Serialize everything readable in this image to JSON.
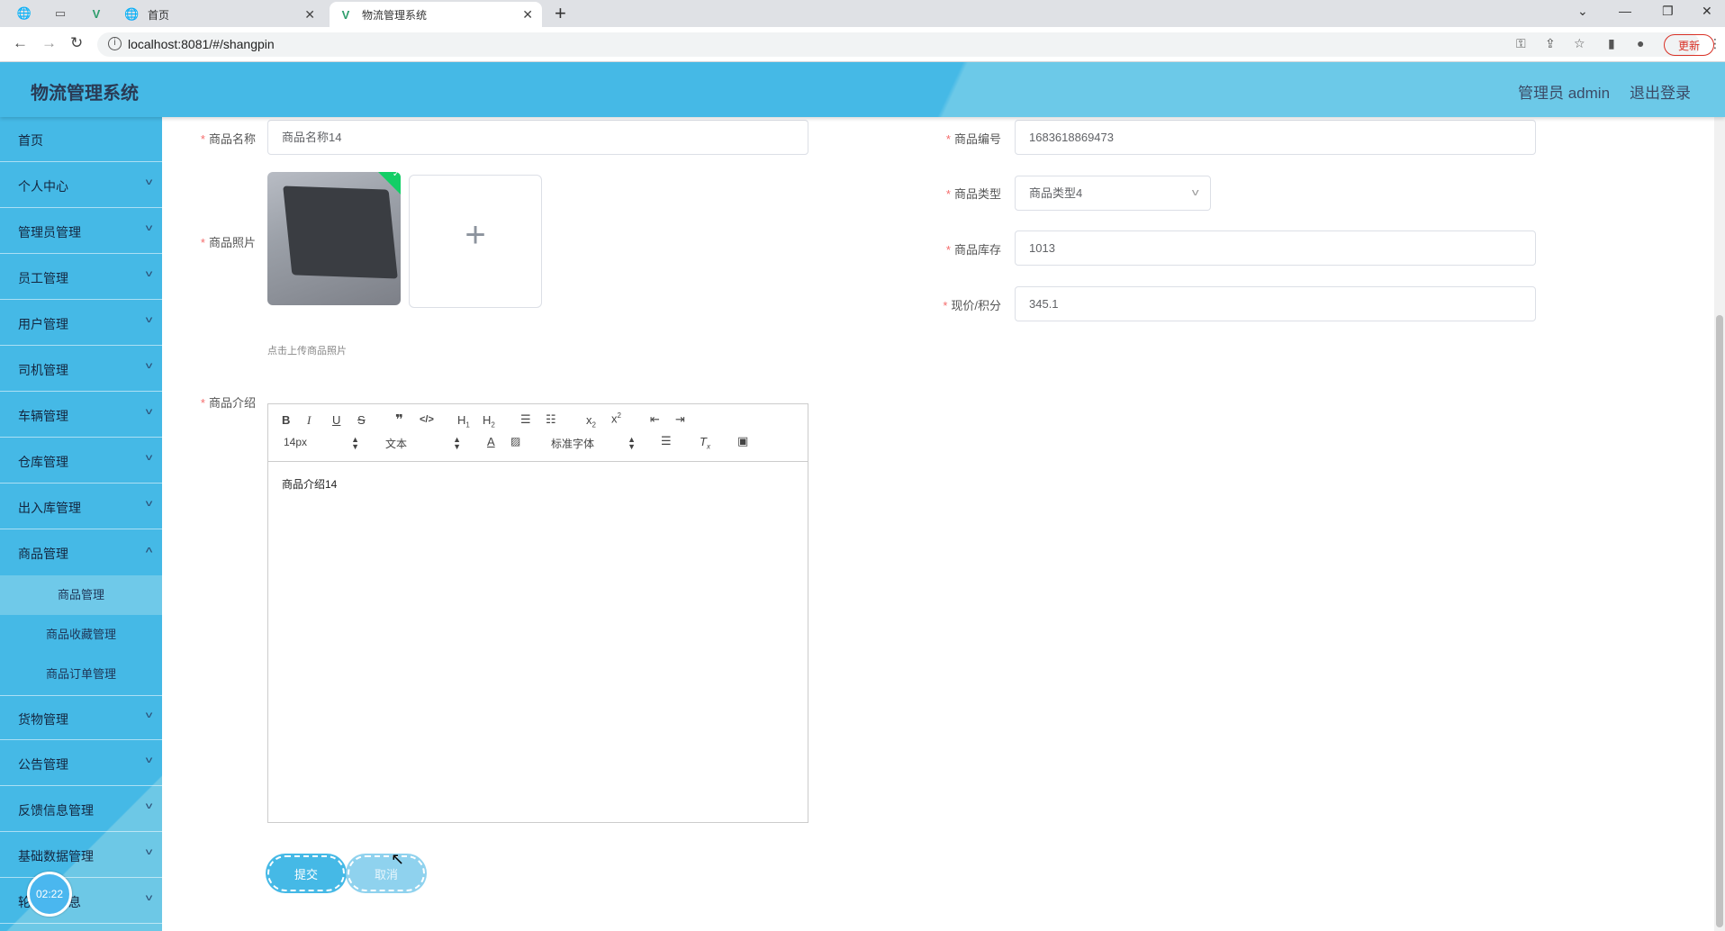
{
  "browser": {
    "tabs": [
      {
        "title": "首页",
        "icon": "globe-icon"
      },
      {
        "title": "物流管理系统",
        "icon": "vue-icon"
      }
    ],
    "url": "localhost:8081/#/shangpin",
    "update_label": "更新"
  },
  "header": {
    "title": "物流管理系统",
    "admin": "管理员 admin",
    "logout": "退出登录"
  },
  "sidebar": {
    "items": [
      {
        "label": "首页"
      },
      {
        "label": "个人中心"
      },
      {
        "label": "管理员管理"
      },
      {
        "label": "员工管理"
      },
      {
        "label": "用户管理"
      },
      {
        "label": "司机管理"
      },
      {
        "label": "车辆管理"
      },
      {
        "label": "仓库管理"
      },
      {
        "label": "出入库管理"
      },
      {
        "label": "商品管理"
      }
    ],
    "sub_items": [
      {
        "label": "商品管理"
      },
      {
        "label": "商品收藏管理"
      },
      {
        "label": "商品订单管理"
      }
    ],
    "items_after": [
      {
        "label": "货物管理"
      },
      {
        "label": "公告管理"
      },
      {
        "label": "反馈信息管理"
      },
      {
        "label": "基础数据管理"
      },
      {
        "label": "轮播图信息"
      }
    ],
    "timer": "02:22"
  },
  "form": {
    "name_label": "商品名称",
    "name_value": "商品名称14",
    "code_label": "商品编号",
    "code_value": "1683618869473",
    "photo_label": "商品照片",
    "photo_tip": "点击上传商品照片",
    "type_label": "商品类型",
    "type_value": "商品类型4",
    "stock_label": "商品库存",
    "stock_value": "1013",
    "price_label": "现价/积分",
    "price_value": "345.1",
    "intro_label": "商品介绍",
    "intro_value": "商品介绍14",
    "editor": {
      "size": "14px",
      "header": "文本",
      "font": "标准字体"
    },
    "submit": "提交",
    "cancel": "取消"
  }
}
